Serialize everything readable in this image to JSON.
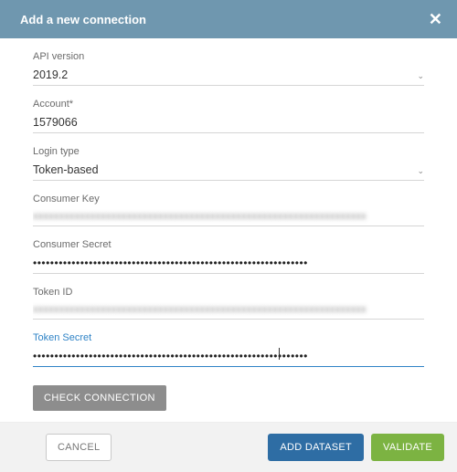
{
  "header": {
    "title": "Add a new connection",
    "close_label": "✕"
  },
  "fields": {
    "api_version": {
      "label": "API version",
      "value": "2019.2"
    },
    "account": {
      "label": "Account*",
      "value": "1579066"
    },
    "login_type": {
      "label": "Login type",
      "value": "Token-based"
    },
    "consumer_key": {
      "label": "Consumer Key",
      "value": "xxxxxxxxxxxxxxxxxxxxxxxxxxxxxxxxxxxxxxxxxxxxxxxxxxxxxxxxxxxxxxxx"
    },
    "consumer_secret": {
      "label": "Consumer Secret",
      "value": "••••••••••••••••••••••••••••••••••••••••••••••••••••••••••••••••"
    },
    "token_id": {
      "label": "Token ID",
      "value": "xxxxxxxxxxxxxxxxxxxxxxxxxxxxxxxxxxxxxxxxxxxxxxxxxxxxxxxxxxxxxxxx"
    },
    "token_secret": {
      "label": "Token Secret",
      "value": "••••••••••••••••••••••••••••••••••••••••••••••••••••••••••••••••"
    }
  },
  "actions": {
    "check_connection": "CHECK CONNECTION",
    "cancel": "CANCEL",
    "add_dataset": "ADD DATASET",
    "validate": "VALIDATE"
  }
}
